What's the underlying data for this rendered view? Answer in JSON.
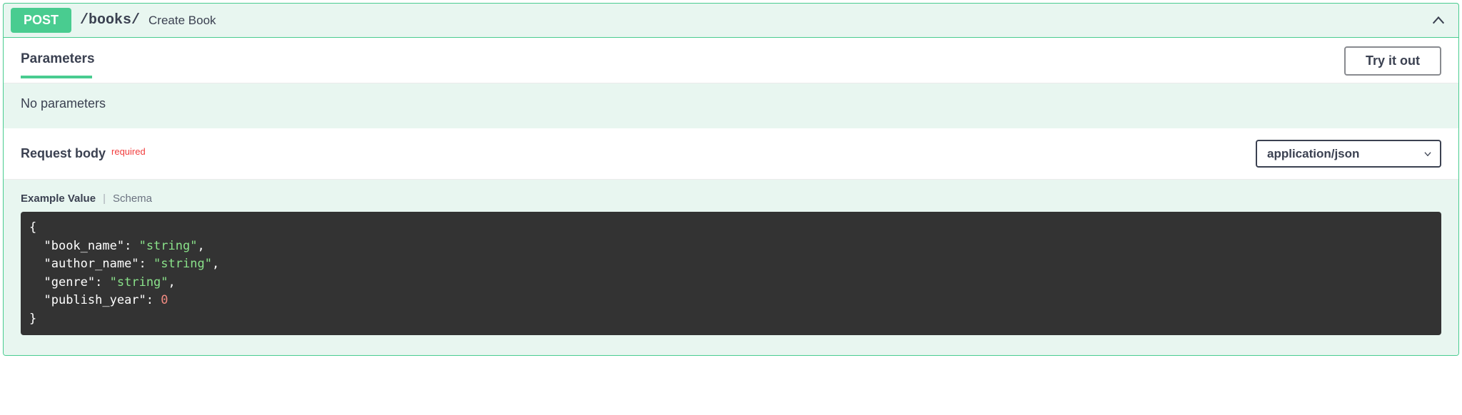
{
  "method": "POST",
  "path": "/books/",
  "summary": "Create Book",
  "sections": {
    "parameters_label": "Parameters",
    "try_it_out": "Try it out",
    "no_parameters": "No parameters",
    "request_body_label": "Request body",
    "required_label": "required",
    "content_type": "application/json",
    "example_value_tab": "Example Value",
    "schema_tab": "Schema"
  },
  "example_body": {
    "fields": [
      {
        "key": "book_name",
        "type": "string",
        "value": "string"
      },
      {
        "key": "author_name",
        "type": "string",
        "value": "string"
      },
      {
        "key": "genre",
        "type": "string",
        "value": "string"
      },
      {
        "key": "publish_year",
        "type": "number",
        "value": "0"
      }
    ]
  }
}
